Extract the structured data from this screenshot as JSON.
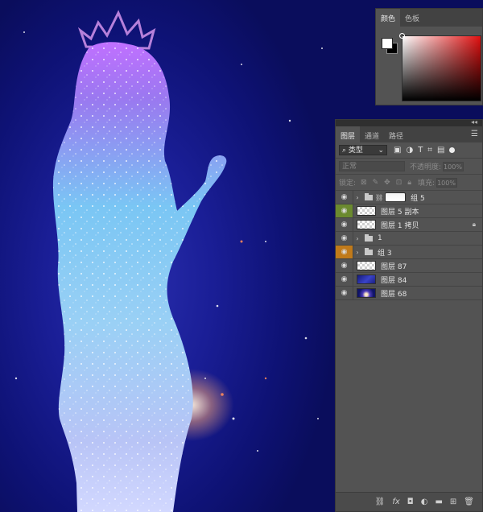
{
  "color_panel": {
    "tabs": [
      "颜色",
      "色板"
    ],
    "active_tab": 0
  },
  "layers_panel": {
    "tabs": [
      "图层",
      "通道",
      "路径"
    ],
    "active_tab": 0,
    "collapse_glyph": "◂◂",
    "filter": {
      "label": "类型",
      "icons": [
        "image-filter-icon",
        "adjustment-filter-icon",
        "text-filter-icon",
        "shape-filter-icon",
        "smart-object-filter-icon"
      ]
    },
    "blend_mode": "正常",
    "opacity_label": "不透明度:",
    "opacity_value": "100%",
    "lock_label": "锁定:",
    "fill_label": "填充:",
    "fill_value": "100%",
    "layers": [
      {
        "name": "组 5",
        "type": "group",
        "eye_highlight": "none",
        "has_mask": true
      },
      {
        "name": "图层 5 副本",
        "type": "layer",
        "eye_highlight": "green",
        "thumb": "checker"
      },
      {
        "name": "图层 1 拷贝",
        "type": "layer",
        "eye_highlight": "none",
        "thumb": "checker",
        "locked": true
      },
      {
        "name": "1",
        "type": "group",
        "eye_highlight": "none"
      },
      {
        "name": "组 3",
        "type": "group",
        "eye_highlight": "orange"
      },
      {
        "name": "图层 87",
        "type": "layer",
        "eye_highlight": "none",
        "thumb": "checker"
      },
      {
        "name": "图层 84",
        "type": "layer",
        "eye_highlight": "none",
        "thumb": "dark"
      },
      {
        "name": "图层 68",
        "type": "layer",
        "eye_highlight": "none",
        "thumb": "dark2"
      }
    ],
    "bottom_icons": [
      "link-layers-icon",
      "fx-icon",
      "add-mask-icon",
      "adjustment-layer-icon",
      "new-group-icon",
      "new-layer-icon",
      "delete-layer-icon"
    ]
  },
  "colors": {
    "panel_bg": "#535353",
    "canvas_bg": "#0e1275",
    "eye_green": "#6b8a2f",
    "eye_orange": "#c07a1a"
  }
}
